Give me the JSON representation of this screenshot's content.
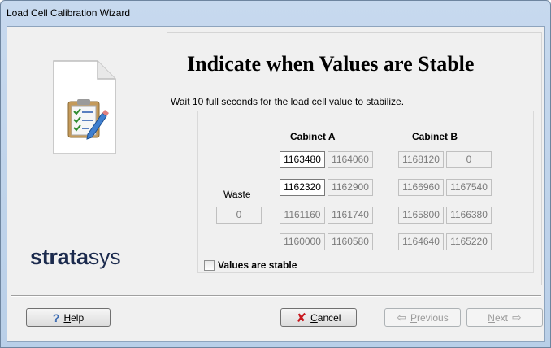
{
  "window": {
    "title": "Load Cell Calibration Wizard"
  },
  "branding": {
    "logo_bold": "strata",
    "logo_light": "sys"
  },
  "page": {
    "heading": "Indicate when Values are Stable",
    "instruction": "Wait 10 full seconds for the load cell value to stabilize."
  },
  "readings": {
    "cabinet_a_label": "Cabinet A",
    "cabinet_b_label": "Cabinet B",
    "waste_label": "Waste",
    "waste_value": "0",
    "rows": [
      {
        "a1": "1163480",
        "a2": "1164060",
        "b1": "1168120",
        "b2": "0"
      },
      {
        "a1": "1162320",
        "a2": "1162900",
        "b1": "1166960",
        "b2": "1167540"
      },
      {
        "a1": "1161160",
        "a2": "1161740",
        "b1": "1165800",
        "b2": "1166380"
      },
      {
        "a1": "1160000",
        "a2": "1160580",
        "b1": "1164640",
        "b2": "1165220"
      }
    ]
  },
  "stable_checkbox": {
    "label": "Values are stable",
    "checked": false
  },
  "buttons": {
    "help": {
      "accel": "H",
      "rest": "elp",
      "icon": "help-icon"
    },
    "cancel": {
      "accel": "C",
      "rest": "ancel",
      "icon": "cancel-x-icon"
    },
    "previous": {
      "accel": "P",
      "rest": "revious",
      "icon": "arrow-left-icon",
      "enabled": false
    },
    "next": {
      "accel": "N",
      "rest": "ext",
      "icon": "arrow-right-icon",
      "enabled": false
    }
  },
  "colors": {
    "cancel_icon": "#c8181e",
    "help_icon": "#3a6ab2",
    "logo": "#1b2a4d"
  }
}
